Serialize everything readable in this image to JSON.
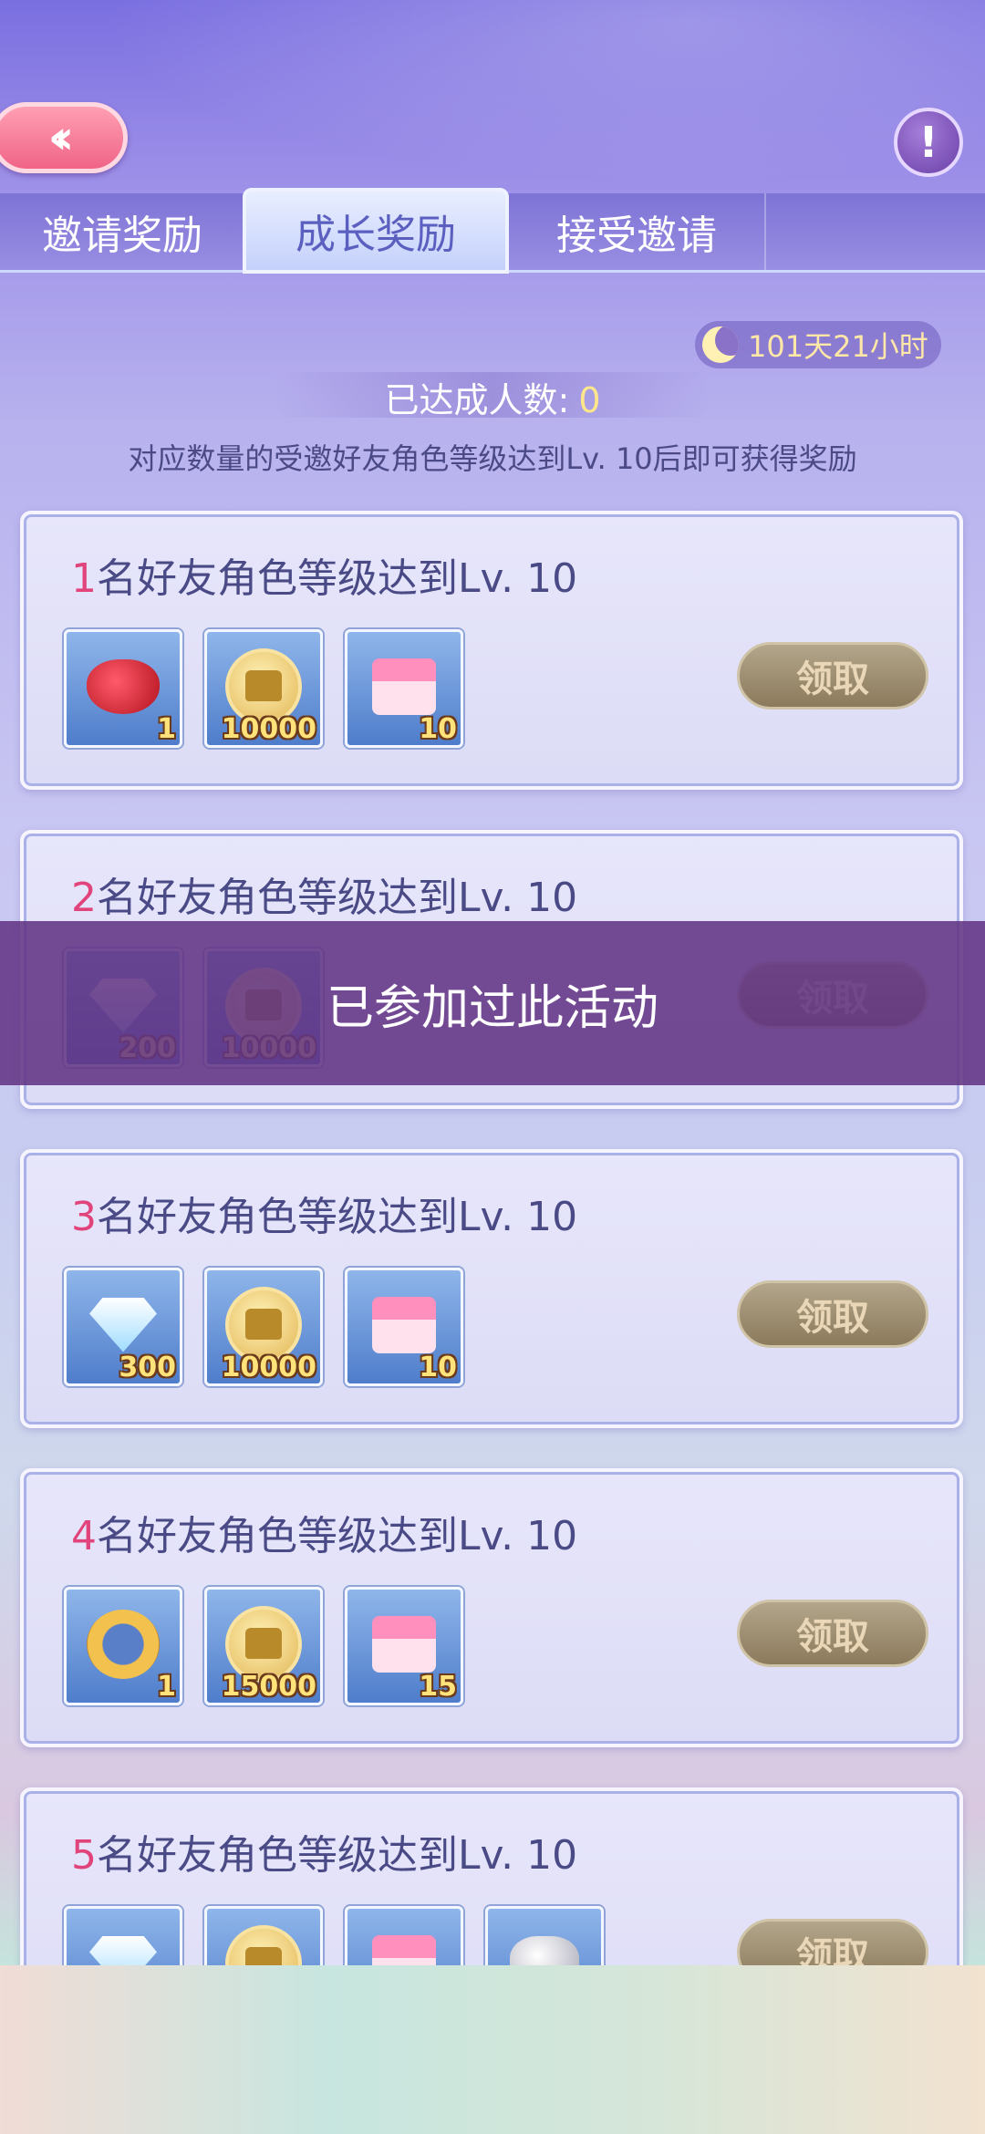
{
  "tabs": [
    "邀请奖励",
    "成长奖励",
    "接受邀请"
  ],
  "timer": "101天21小时",
  "progress": {
    "label": "已达成人数:",
    "value": "0"
  },
  "description": "对应数量的受邀好友角色等级达到Lv. 10后即可获得奖励",
  "claim_label": "领取",
  "toast": "已参加过此活动",
  "rewards": [
    {
      "num": "1",
      "text": "名好友角色等级达到Lv. 10",
      "items": [
        {
          "icon": "red-teapot-icon",
          "count": "1"
        },
        {
          "icon": "coin-shirt-icon",
          "count": "10000"
        },
        {
          "icon": "gift-box-icon",
          "count": "10"
        }
      ]
    },
    {
      "num": "2",
      "text": "名好友角色等级达到Lv. 10",
      "items": [
        {
          "icon": "diamond-icon",
          "count": "200"
        },
        {
          "icon": "coin-shirt-icon",
          "count": "10000"
        }
      ]
    },
    {
      "num": "3",
      "text": "名好友角色等级达到Lv. 10",
      "items": [
        {
          "icon": "diamond-icon",
          "count": "300"
        },
        {
          "icon": "coin-shirt-icon",
          "count": "10000"
        },
        {
          "icon": "gift-box-icon",
          "count": "10"
        }
      ]
    },
    {
      "num": "4",
      "text": "名好友角色等级达到Lv. 10",
      "items": [
        {
          "icon": "gold-ring-icon",
          "count": "1"
        },
        {
          "icon": "coin-shirt-icon",
          "count": "15000"
        },
        {
          "icon": "gift-box-icon",
          "count": "15"
        }
      ]
    },
    {
      "num": "5",
      "text": "名好友角色等级达到Lv. 10",
      "items": [
        {
          "icon": "diamond-icon",
          "count": ""
        },
        {
          "icon": "coin-shirt-icon",
          "count": ""
        },
        {
          "icon": "gift-box-icon",
          "count": ""
        },
        {
          "icon": "silver-bag-icon",
          "count": ""
        }
      ]
    }
  ]
}
